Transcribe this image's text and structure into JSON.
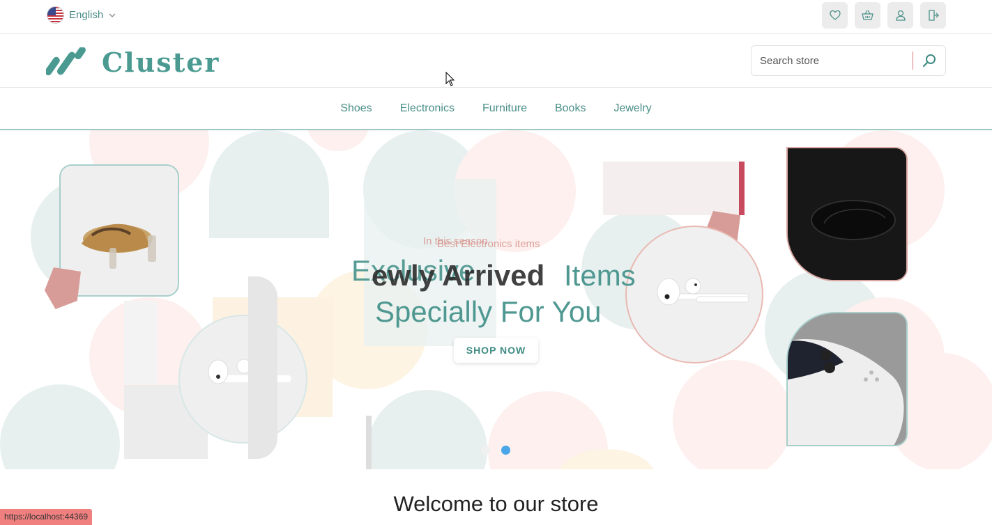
{
  "topbar": {
    "language_label": "English",
    "icons": [
      "heart-icon",
      "basket-icon",
      "user-icon",
      "logout-icon"
    ]
  },
  "header": {
    "brand_name": "Cluster",
    "search_placeholder": "Search store"
  },
  "nav": {
    "items": [
      "Shoes",
      "Electronics",
      "Furniture",
      "Books",
      "Jewelry"
    ]
  },
  "hero": {
    "subtitle_prev": "In this season",
    "subtitle_next": "Best Electronics items",
    "headline_prev_line1": "Exclusive",
    "headline_next_line1": "ewly Arrived",
    "headline_line1_end": "Items",
    "headline_line2": "Specially For You",
    "cta_label": "SHOP NOW",
    "slides_count": 2,
    "active_slide": 2
  },
  "welcome_title": "Welcome to our store",
  "status_bar_url": "https://localhost:44369",
  "colors": {
    "accent": "#4a9a91",
    "pink": "#d8938c",
    "dot_active": "#4aa6e8"
  }
}
